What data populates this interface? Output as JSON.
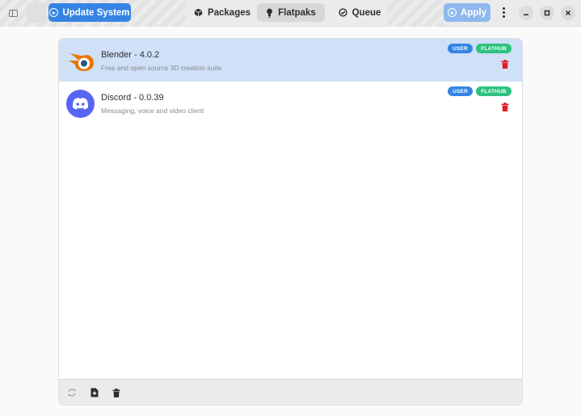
{
  "header": {
    "update_label": "Update System",
    "tabs": [
      {
        "label": "Packages",
        "icon": "package-icon"
      },
      {
        "label": "Flatpaks",
        "icon": "flatpak-icon",
        "active": true
      },
      {
        "label": "Queue",
        "icon": "queue-check-icon"
      }
    ],
    "apply_label": "Apply",
    "accent_color": "#3584e4"
  },
  "apps": [
    {
      "name": "Blender - 4.0.2",
      "description": "Free and open source 3D creation suite",
      "installation": "USER",
      "remote": "FLATHUB",
      "icon": "blender-icon",
      "selected": true
    },
    {
      "name": "Discord - 0.0.39",
      "description": "Messaging, voice and video client",
      "installation": "USER",
      "remote": "FLATHUB",
      "icon": "discord-icon",
      "selected": false
    }
  ],
  "colors": {
    "user_badge": "#3584e4",
    "flathub_badge": "#2ec27e",
    "delete": "#e01b24",
    "selected_row": "#cfe0f7"
  }
}
